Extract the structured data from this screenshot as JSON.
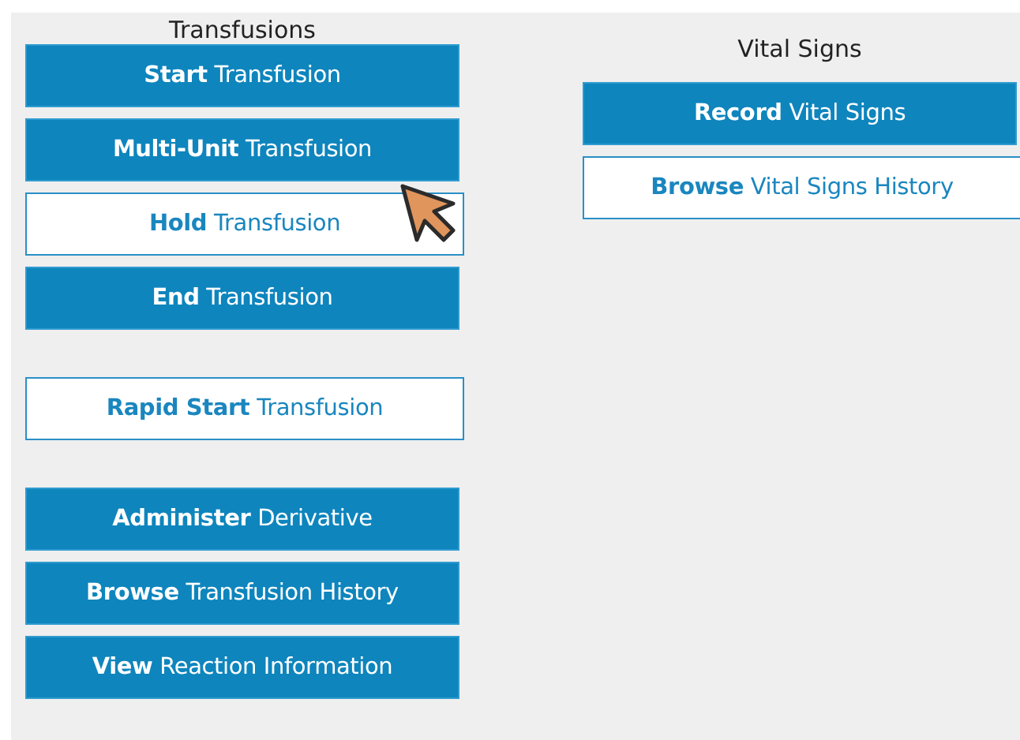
{
  "columns": [
    {
      "title": "Transfusions",
      "groups": [
        [
          {
            "label": "**Start** Transfusion",
            "kind": "filled"
          },
          {
            "label": "**Multi-Unit** Transfusion",
            "kind": "filled"
          },
          {
            "label": "**Hold** Transfusion",
            "kind": "outline"
          },
          {
            "label": "**End** Transfusion",
            "kind": "filled"
          }
        ],
        [
          {
            "label": "**Rapid Start** Transfusion",
            "kind": "outline"
          }
        ],
        [
          {
            "label": "**Administer** Derivative",
            "kind": "filled"
          },
          {
            "label": "**Browse** Transfusion History",
            "kind": "filled"
          },
          {
            "label": "**View** Reaction Information",
            "kind": "filled"
          }
        ]
      ]
    },
    {
      "title": "Vital Signs",
      "groups": [
        [
          {
            "label": "**Record** Vital Signs",
            "kind": "filled"
          },
          {
            "label": "**Browse** Vital Signs History",
            "kind": "outline"
          }
        ]
      ]
    }
  ]
}
